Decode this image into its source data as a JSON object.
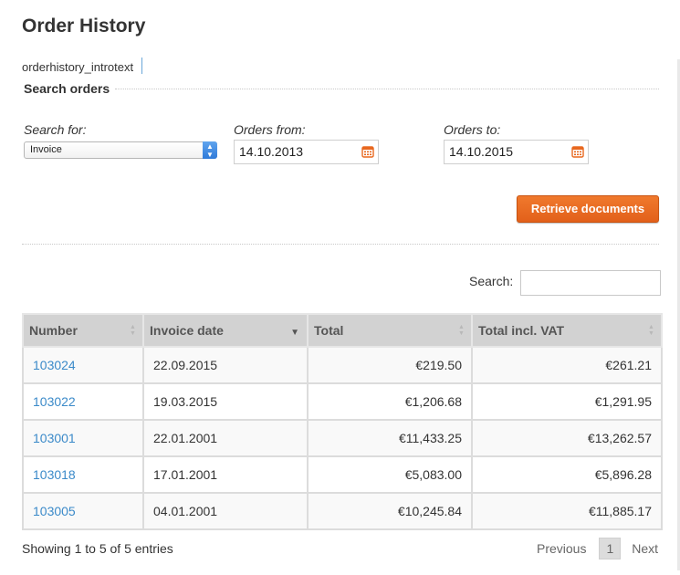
{
  "page": {
    "title": "Order History",
    "intro": "orderhistory_introtext",
    "legend": "Search orders"
  },
  "form": {
    "search_for_label": "Search for:",
    "search_for_value": "Invoice",
    "orders_from_label": "Orders from:",
    "orders_from_value": "14.10.2013",
    "orders_to_label": "Orders to:",
    "orders_to_value": "14.10.2015",
    "retrieve_label": "Retrieve documents"
  },
  "search": {
    "label": "Search:",
    "value": ""
  },
  "table": {
    "headers": [
      "Number",
      "Invoice date",
      "Total",
      "Total incl. VAT"
    ],
    "rows": [
      {
        "number": "103024",
        "date": "22.09.2015",
        "total": "€219.50",
        "total_vat": "€261.21"
      },
      {
        "number": "103022",
        "date": "19.03.2015",
        "total": "€1,206.68",
        "total_vat": "€1,291.95"
      },
      {
        "number": "103001",
        "date": "22.01.2001",
        "total": "€11,433.25",
        "total_vat": "€13,262.57"
      },
      {
        "number": "103018",
        "date": "17.01.2001",
        "total": "€5,083.00",
        "total_vat": "€5,896.28"
      },
      {
        "number": "103005",
        "date": "04.01.2001",
        "total": "€10,245.84",
        "total_vat": "€11,885.17"
      }
    ]
  },
  "footer": {
    "info": "Showing 1 to 5 of 5 entries",
    "previous": "Previous",
    "current_page": "1",
    "next": "Next"
  },
  "colors": {
    "accent": "#e8681f",
    "link": "#3b8ac9",
    "header_bg": "#d2d2d2"
  }
}
